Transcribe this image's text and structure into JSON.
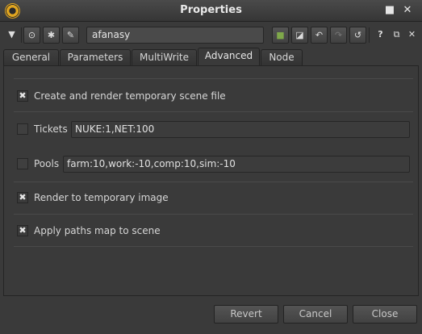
{
  "window": {
    "title": "Properties",
    "controls": {
      "restore": "■",
      "close": "✕"
    }
  },
  "toolbar": {
    "node_name": "afanasy",
    "icons": {
      "collapse": "▼",
      "center": "⊙",
      "bug": "✱",
      "wrench": "✎",
      "color": "■",
      "default_color": "◪",
      "undo": "↶",
      "redo": "↷",
      "revert": "↺",
      "help": "?",
      "float": "⧉",
      "close": "✕"
    }
  },
  "tabs": [
    {
      "label": "General"
    },
    {
      "label": "Parameters"
    },
    {
      "label": "MultiWrite"
    },
    {
      "label": "Advanced"
    },
    {
      "label": "Node"
    }
  ],
  "advanced": {
    "render_temp_scene": {
      "label": "Create and render temporary scene file",
      "checked": true,
      "mark": "✖"
    },
    "tickets": {
      "label": "Tickets",
      "checked": false,
      "value": "NUKE:1,NET:100"
    },
    "pools": {
      "label": "Pools",
      "checked": false,
      "value": "farm:10,work:-10,comp:10,sim:-10"
    },
    "render_temp_image": {
      "label": "Render to temporary image",
      "checked": true,
      "mark": "✖"
    },
    "apply_paths_map": {
      "label": "Apply paths map to scene",
      "checked": true,
      "mark": "✖"
    }
  },
  "buttons": {
    "revert": "Revert",
    "cancel": "Cancel",
    "close": "Close"
  }
}
